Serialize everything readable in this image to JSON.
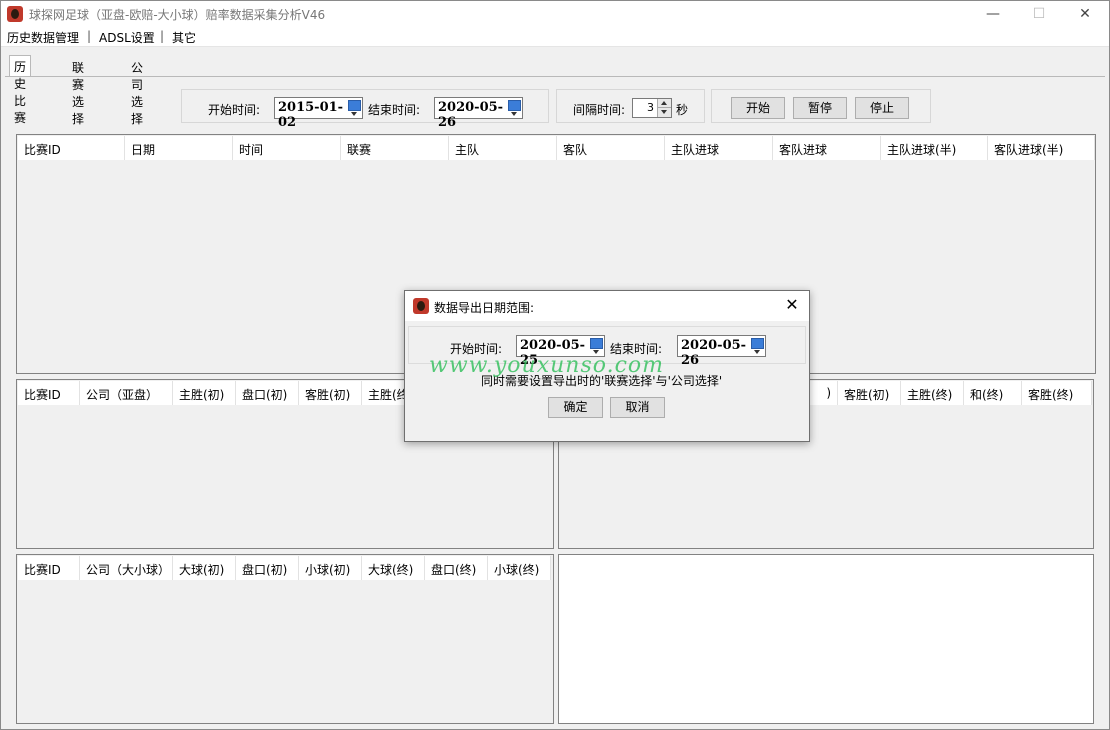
{
  "window": {
    "title": "球探网足球（亚盘-欧赔-大小球）赔率数据采集分析V46",
    "minimize": "—",
    "maximize": "☐",
    "close": "✕"
  },
  "menu": {
    "items": [
      "历史数据管理",
      "ADSL设置",
      "其它"
    ],
    "separator": "|"
  },
  "tabs": [
    "历史比赛",
    "联赛选择",
    "公司选择"
  ],
  "toolbar": {
    "start_label": "开始时间:",
    "start_date": "2015-01-02",
    "end_label": "结束时间:",
    "end_date": "2020-05-26",
    "interval_label": "间隔时间:",
    "interval_value": "3",
    "interval_unit": "秒",
    "btn_start": "开始",
    "btn_pause": "暂停",
    "btn_stop": "停止"
  },
  "main_grid": {
    "columns": [
      "比赛ID",
      "日期",
      "时间",
      "联赛",
      "主队",
      "客队",
      "主队进球",
      "客队进球",
      "主队进球(半)",
      "客队进球(半)"
    ]
  },
  "asian_grid": {
    "columns": [
      "比赛ID",
      "公司（亚盘）",
      "主胜(初)",
      "盘口(初)",
      "客胜(初)",
      "主胜(终"
    ]
  },
  "euro_grid": {
    "columns": [
      ")",
      "客胜(初)",
      "主胜(终)",
      "和(终)",
      "客胜(终)"
    ]
  },
  "ou_grid": {
    "columns": [
      "比赛ID",
      "公司（大小球）",
      "大球(初)",
      "盘口(初)",
      "小球(初)",
      "大球(终)",
      "盘口(终)",
      "小球(终)"
    ]
  },
  "dialog": {
    "title": "数据导出日期范围:",
    "close": "✕",
    "start_label": "开始时间:",
    "start_date": "2020-05-25",
    "end_label": "结束时间:",
    "end_date": "2020-05-26",
    "note": "同时需要设置导出时的'联赛选择'与'公司选择'",
    "ok": "确定",
    "cancel": "取消"
  },
  "watermark": "www.youxunso.com"
}
